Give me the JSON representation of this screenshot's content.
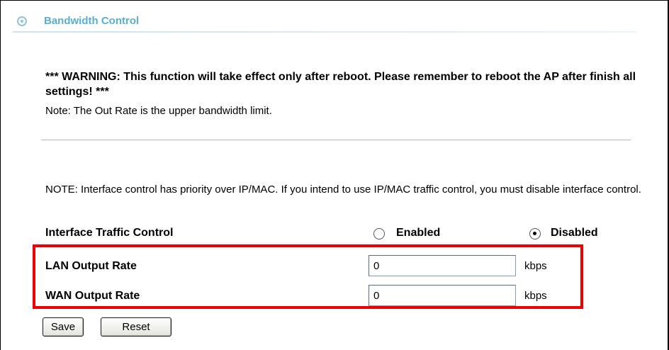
{
  "header": {
    "title": "Bandwidth Control",
    "icon": "bullet-circle-icon",
    "accent_color": "#5aaed0"
  },
  "warning_text": "*** WARNING: This function will take effect only after reboot. Please remember to reboot the AP after finish all settings! ***",
  "note_out_rate": "Note: The Out Rate is the upper bandwidth limit.",
  "note_interface": "NOTE: Interface control has priority over IP/MAC. If you intend to use IP/MAC traffic control, you must disable interface control.",
  "interface_traffic_control": {
    "label": "Interface Traffic Control",
    "options": [
      {
        "label": "Enabled",
        "selected": false
      },
      {
        "label": "Disabled",
        "selected": true
      }
    ]
  },
  "lan_output_rate": {
    "label": "LAN Output Rate",
    "value": "0",
    "unit": "kbps"
  },
  "wan_output_rate": {
    "label": "WAN Output Rate",
    "value": "0",
    "unit": "kbps"
  },
  "highlight_color": "#ee0000",
  "buttons": {
    "save": "Save",
    "reset": "Reset"
  }
}
